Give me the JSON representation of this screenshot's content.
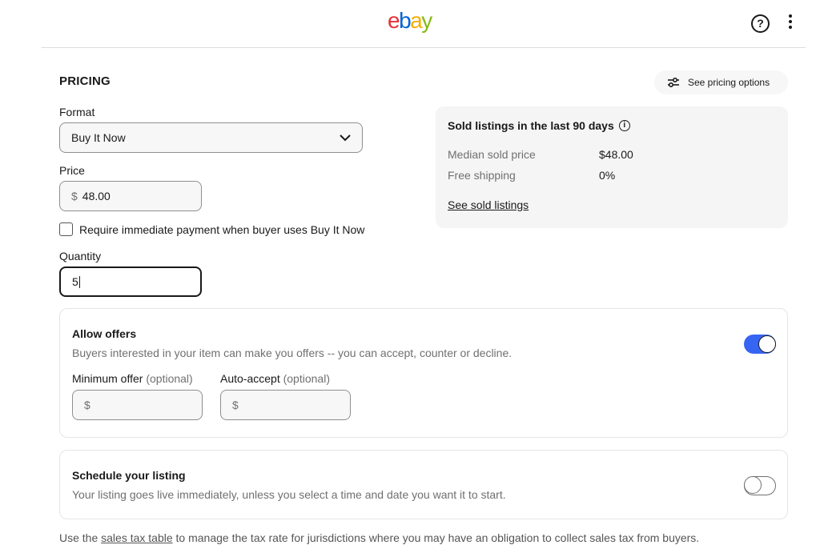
{
  "header": {
    "logo": [
      "e",
      "b",
      "a",
      "y"
    ],
    "help_icon": "?",
    "more_icon": "vertical-ellipsis"
  },
  "pricing": {
    "section_title": "PRICING",
    "see_pricing_options": "See pricing options",
    "format": {
      "label": "Format",
      "value": "Buy It Now"
    },
    "price": {
      "label": "Price",
      "currency": "$",
      "value": "48.00"
    },
    "immediate_payment": {
      "label": "Require immediate payment when buyer uses Buy It Now",
      "checked": false
    },
    "quantity": {
      "label": "Quantity",
      "value": "5"
    }
  },
  "sold_listings": {
    "title": "Sold listings in the last 90 days",
    "stats": [
      {
        "label": "Median sold price",
        "value": "$48.00"
      },
      {
        "label": "Free shipping",
        "value": "0%"
      }
    ],
    "link": "See sold listings"
  },
  "allow_offers": {
    "title": "Allow offers",
    "description": "Buyers interested in your item can make you offers -- you can accept, counter or decline.",
    "enabled": true,
    "minimum_offer": {
      "label": "Minimum offer",
      "optional": "(optional)",
      "currency": "$",
      "value": ""
    },
    "auto_accept": {
      "label": "Auto-accept",
      "optional": "(optional)",
      "currency": "$",
      "value": ""
    }
  },
  "schedule": {
    "title": "Schedule your listing",
    "description": "Your listing goes live immediately, unless you select a time and date you want it to start.",
    "enabled": false
  },
  "footer": {
    "prefix": "Use the ",
    "link": "sales tax table",
    "suffix": " to manage the tax rate for jurisdictions where you may have an obligation to collect sales tax from buyers."
  },
  "colors": {
    "accent": "#3665f3",
    "card_bg": "#f5f5f5"
  }
}
